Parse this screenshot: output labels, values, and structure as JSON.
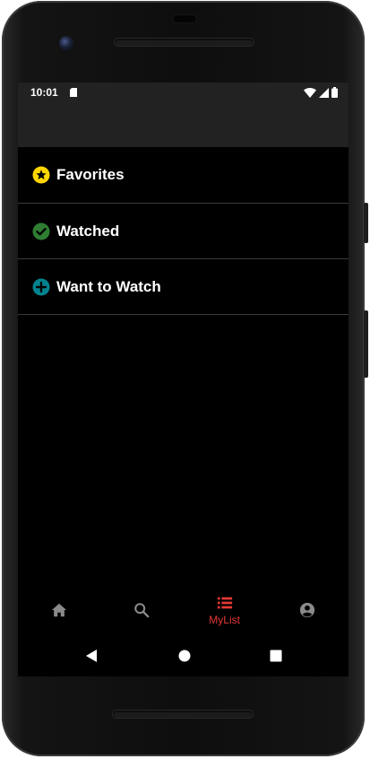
{
  "status_bar": {
    "time": "10:01",
    "icons": [
      "sd-card-icon",
      "wifi-icon",
      "signal-icon",
      "battery-icon"
    ]
  },
  "lists": [
    {
      "label": "Favorites",
      "icon": "star-circle-icon",
      "icon_color": "#FFD600"
    },
    {
      "label": "Watched",
      "icon": "check-circle-icon",
      "icon_color": "#2E7D32"
    },
    {
      "label": "Want to Watch",
      "icon": "plus-circle-icon",
      "icon_color": "#00838F"
    }
  ],
  "bottom_nav": {
    "items": [
      {
        "icon": "home-icon",
        "label": "",
        "active": false
      },
      {
        "icon": "search-icon",
        "label": "",
        "active": false
      },
      {
        "icon": "list-icon",
        "label": "MyList",
        "active": true
      },
      {
        "icon": "account-circle-icon",
        "label": "",
        "active": false
      }
    ],
    "active_color": "#E53935",
    "inactive_color": "#8A8A8A"
  },
  "system_nav": [
    "back-icon",
    "home-circle-icon",
    "recents-icon"
  ],
  "colors": {
    "background": "#000000",
    "app_bar": "#222222",
    "divider": "#3A3A3A",
    "text": "#FFFFFF"
  }
}
